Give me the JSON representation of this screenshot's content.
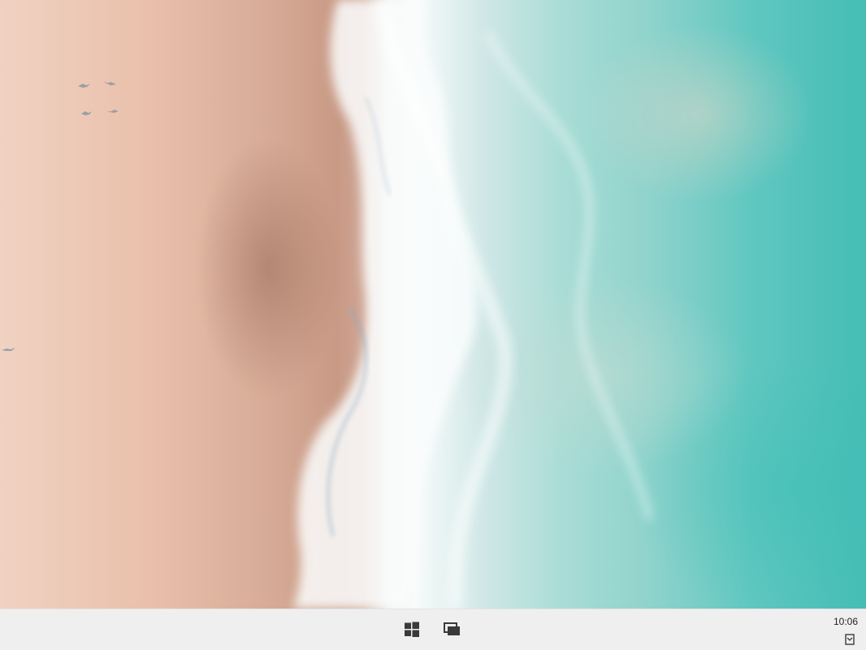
{
  "desktop": {
    "wallpaper": "aerial-beach-waves",
    "sand_color": "#e9bfaa",
    "foam_color": "#f7fbfa",
    "sea_color": "#5fc7c0"
  },
  "taskbar": {
    "background": "#efefef",
    "start_icon": "windows-logo-icon",
    "task_view_icon": "task-view-icon",
    "clock_time": "10:06",
    "tray_icon": "notification-icon"
  }
}
